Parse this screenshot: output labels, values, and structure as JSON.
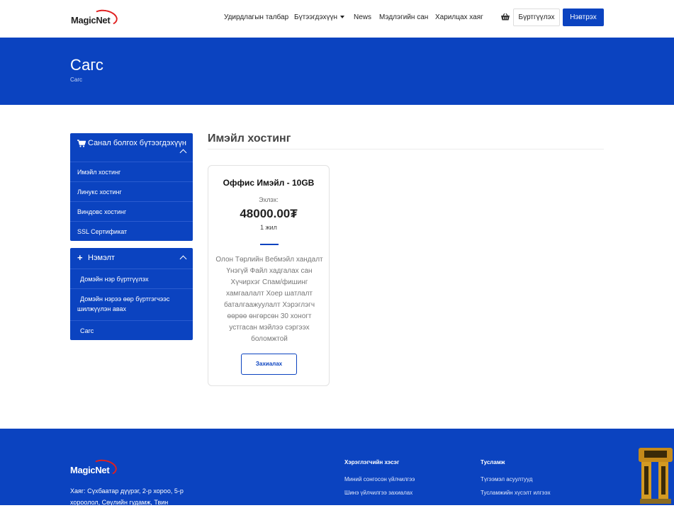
{
  "brand": {
    "name": "MagicNet"
  },
  "nav": {
    "items": [
      "Удирдлагын талбар",
      "Бүтээгдэхүүн",
      "News",
      "Мэдлэгийн сан",
      "Харилцах хаяг"
    ],
    "register": "Бүртгүүлэх",
    "login": "Нэвтрэх"
  },
  "banner": {
    "title": "Сагс",
    "breadcrumb": "Сагс"
  },
  "sidebar": {
    "products": {
      "title": "Санал болгох бүтээгдэхүүн",
      "items": [
        "Имэйл хостинг",
        "Линукс хостинг",
        "Виндовс хостинг",
        "SSL Сертификат"
      ]
    },
    "extras": {
      "title": "Нэмэлт",
      "items": [
        "Домэйн нэр бүртгүүлэх",
        "Домэйн нэрээ өөр бүртгэгчээс шилжүүлэн авах",
        "Сагс"
      ]
    }
  },
  "main": {
    "title": "Имэйл хостинг",
    "product": {
      "name": "Оффис Имэйл - 10GB",
      "from": "Эхлэх:",
      "price": "48000.00₮",
      "period": "1 жил",
      "description": "Олон Төрлийн Вебмэйл хандалт Үнэгүй Файл хадгалах сан Хүчирхэг Спам/фишинг хамгаалалт Хоер шатлалт баталгаажуулалт Хэрэглэгч өөрөө өнгөрсөн 30 хоногт устгасан мэйлээ сэргээх боломжтой",
      "order": "Захиалах"
    }
  },
  "footer": {
    "address": "Хаяг: Сүхбаатар дүүрэг, 2-р хороо, 5-р хороолол, Сөүлийн гудамж, Твин",
    "col1": {
      "title": "Хэрэглэгчийн хэсэг",
      "links": [
        "Миний сонгосон үйлчилгээ",
        "Шинэ үйлчилгээ захиалах"
      ]
    },
    "col2": {
      "title": "Тусламж",
      "links": [
        "Түгээмэл асуултууд",
        "Тусламжийн хүсэлт илгээх"
      ]
    }
  },
  "colors": {
    "primary": "#0b43c0",
    "accent": "#e02020"
  },
  "icons": {
    "cart": "shopping-basket-icon",
    "products_header": "cart-icon",
    "extras_header": "plus-icon"
  }
}
